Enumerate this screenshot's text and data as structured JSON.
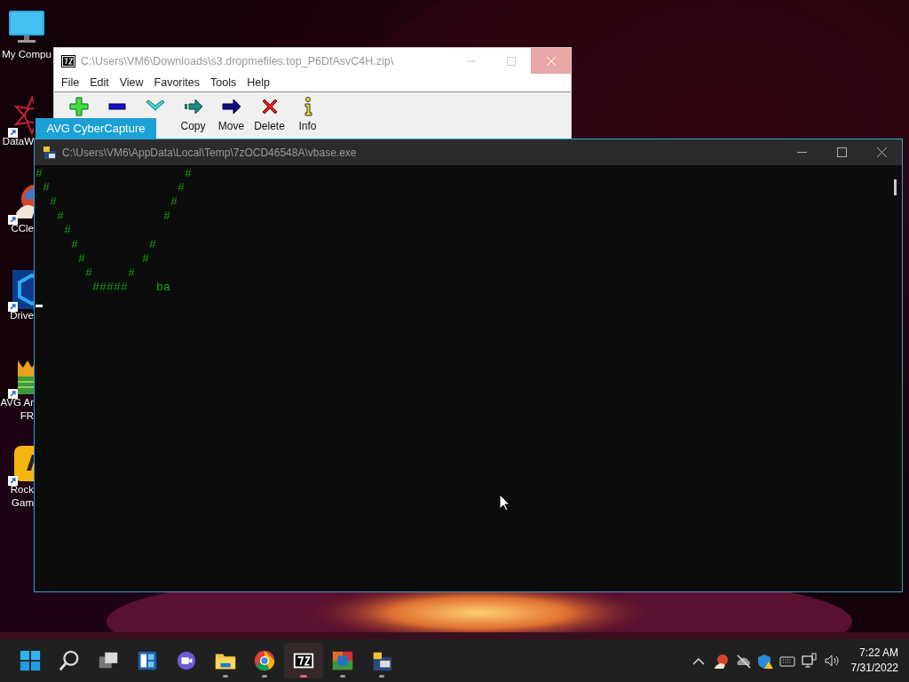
{
  "desktop_icons": [
    {
      "kind": "computer",
      "shortcut": false,
      "label_lines": [
        "My Compu"
      ]
    },
    {
      "kind": "starburst",
      "shortcut": true,
      "label_lines": [
        "DataW"
      ]
    },
    {
      "kind": "cleaner",
      "shortcut": true,
      "label_lines": [
        "CCle"
      ]
    },
    {
      "kind": "hexagon",
      "shortcut": true,
      "label_lines": [
        "Drive"
      ]
    },
    {
      "kind": "crown",
      "shortcut": true,
      "label_lines": [
        "AVG Ar",
        "FR"
      ]
    },
    {
      "kind": "games",
      "shortcut": true,
      "label_lines": [
        "Rock",
        "Gam"
      ]
    }
  ],
  "archiver_window": {
    "title": "C:\\Users\\VM6\\Downloads\\s3.dropmefiles.top_P6DfAsvC4H.zip\\",
    "close_hovered": true,
    "menu": [
      "File",
      "Edit",
      "View",
      "Favorites",
      "Tools",
      "Help"
    ],
    "toolbar": [
      {
        "kind": "add"
      },
      {
        "kind": "remove"
      },
      {
        "kind": "check"
      },
      {
        "kind": "copy",
        "label": "Copy"
      },
      {
        "kind": "move",
        "label": "Move"
      },
      {
        "kind": "delete",
        "label": "Delete"
      },
      {
        "kind": "info",
        "label": "Info"
      }
    ]
  },
  "capture_tab": {
    "label": "AVG CyberCapture"
  },
  "console_window": {
    "title": "C:\\Users\\VM6\\AppData\\Local\\Temp\\7zOCD46548A\\vbase.exe",
    "lines": [
      "#                    #",
      " #                  #",
      "  #                #",
      "   #              #",
      "    #",
      "     #          #",
      "      #        #",
      "       #     #",
      "        #####    ba"
    ]
  },
  "taskbar": {
    "apps": [
      {
        "kind": "start",
        "running": false,
        "selected": false
      },
      {
        "kind": "search",
        "running": false,
        "selected": false
      },
      {
        "kind": "task-view",
        "running": false,
        "selected": false
      },
      {
        "kind": "widgets",
        "running": false,
        "selected": false
      },
      {
        "kind": "chat",
        "running": false,
        "selected": false
      },
      {
        "kind": "folder",
        "running": true,
        "selected": false
      },
      {
        "kind": "browser",
        "running": true,
        "selected": false
      },
      {
        "kind": "archiver",
        "running": true,
        "selected": true
      },
      {
        "kind": "antivirus",
        "running": true,
        "selected": false
      },
      {
        "kind": "console",
        "running": true,
        "selected": false
      }
    ],
    "tray": [
      {
        "kind": "chevron"
      },
      {
        "kind": "cleaner"
      },
      {
        "kind": "cloud-off"
      },
      {
        "kind": "shield"
      },
      {
        "kind": "keyboard"
      },
      {
        "kind": "network"
      },
      {
        "kind": "volume"
      }
    ],
    "time": "7:22 AM",
    "date": "7/31/2022"
  }
}
